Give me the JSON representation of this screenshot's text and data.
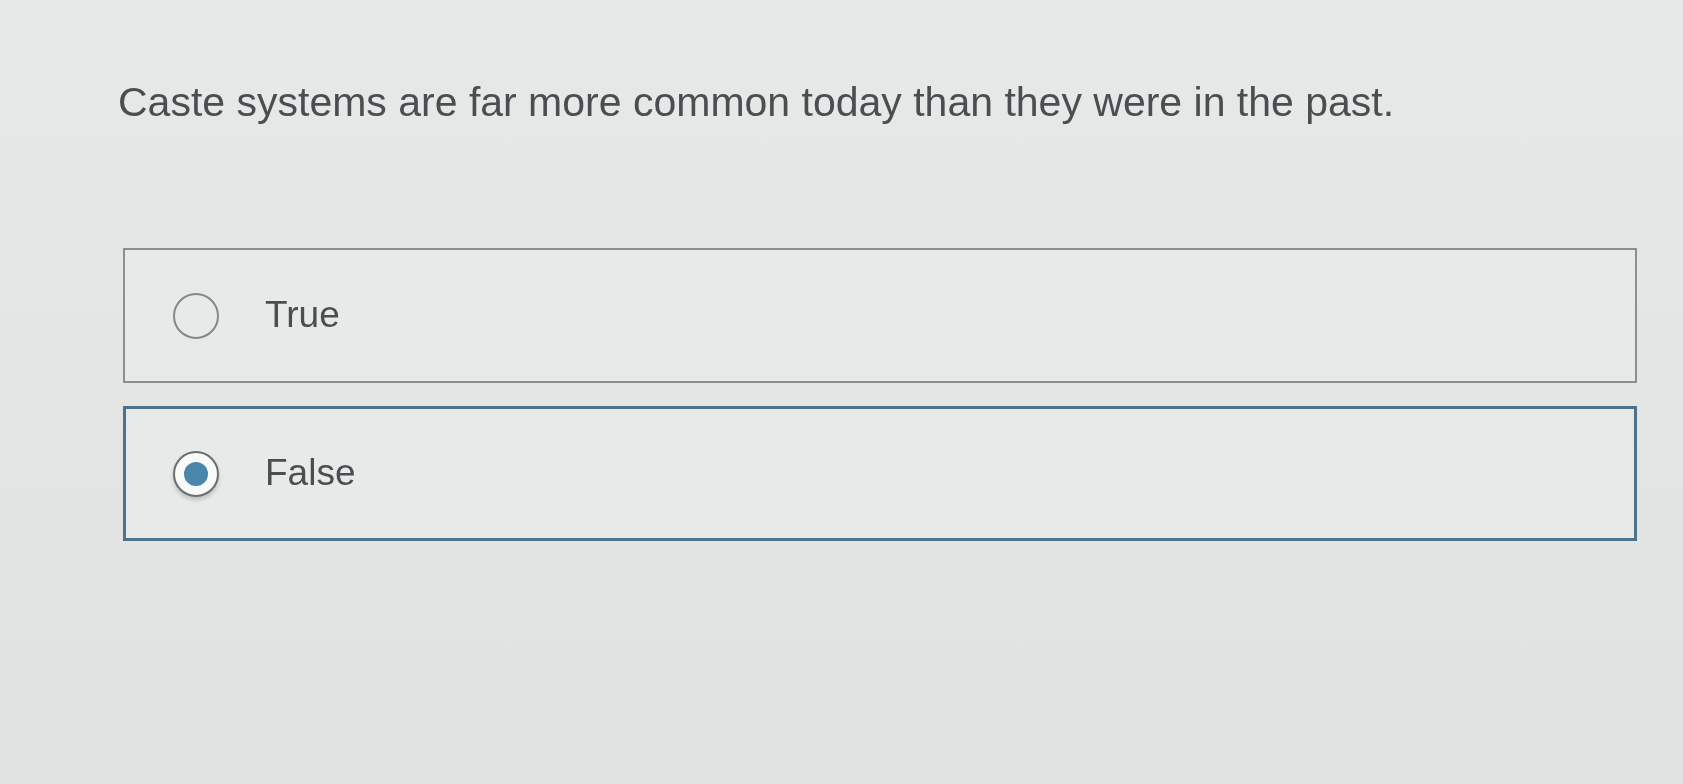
{
  "question": {
    "text": "Caste systems are far more common today than they were in the past."
  },
  "options": [
    {
      "label": "True",
      "selected": false
    },
    {
      "label": "False",
      "selected": true
    }
  ]
}
